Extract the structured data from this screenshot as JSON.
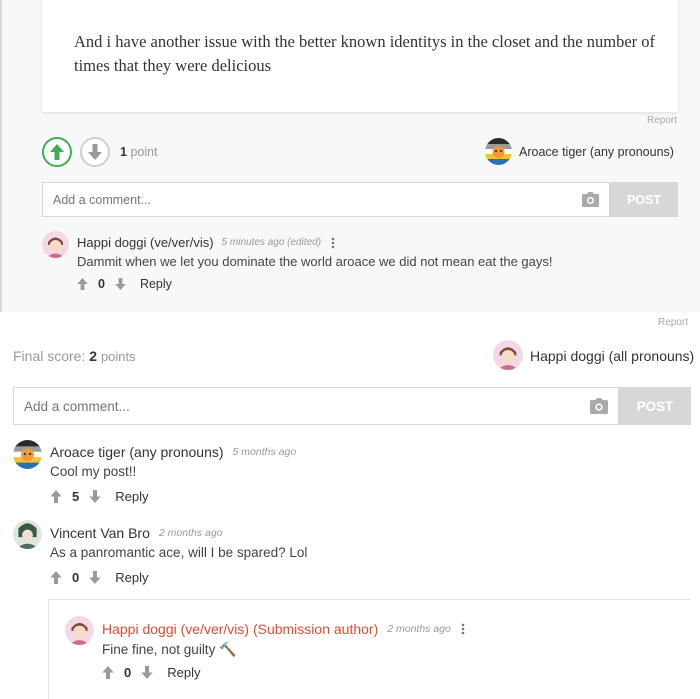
{
  "embed": {
    "quote": "And i have another issue with the better known identitys in the closet and the number of times that they were delicious",
    "report": "Report",
    "points_value": "1",
    "points_unit": "point",
    "op_name": "Aroace tiger (any pronouns)",
    "comment_placeholder": "Add a comment...",
    "post_label": "POST",
    "comment": {
      "name": "Happi doggi (ve/ver/vis)",
      "time": "5 minutes ago (edited)",
      "text": "Dammit when we let you dominate the world aroace we did not mean eat the gays!",
      "votes": "0",
      "reply": "Reply"
    }
  },
  "main": {
    "report": "Report",
    "final_label": "Final score:",
    "final_value": "2",
    "final_unit": "points",
    "op_name": "Happi doggi (all pronouns)",
    "comment_placeholder": "Add a comment...",
    "post_label": "POST",
    "comments": [
      {
        "name": "Aroace tiger (any pronouns)",
        "time": "5 months ago",
        "text": "Cool my post!!",
        "votes": "5",
        "reply": "Reply"
      },
      {
        "name": "Vincent Van Bro",
        "time": "2 months ago",
        "text": "As a panromantic ace, will I be spared? Lol",
        "votes": "0",
        "reply": "Reply"
      }
    ],
    "reply": {
      "name": "Happi doggi (ve/ver/vis) (Submission author)",
      "time": "2 months ago",
      "text": "Fine fine, not guilty",
      "emoji": "🔨",
      "votes": "0",
      "reply": "Reply"
    }
  },
  "colors": {
    "upvote_green": "#3fae52",
    "author_red": "#e04a2f",
    "post_button": "#d7d7d7"
  },
  "icons": [
    "upvote-arrow-icon",
    "downvote-arrow-icon",
    "camera-icon",
    "more-vertical-icon",
    "hammer-icon"
  ]
}
